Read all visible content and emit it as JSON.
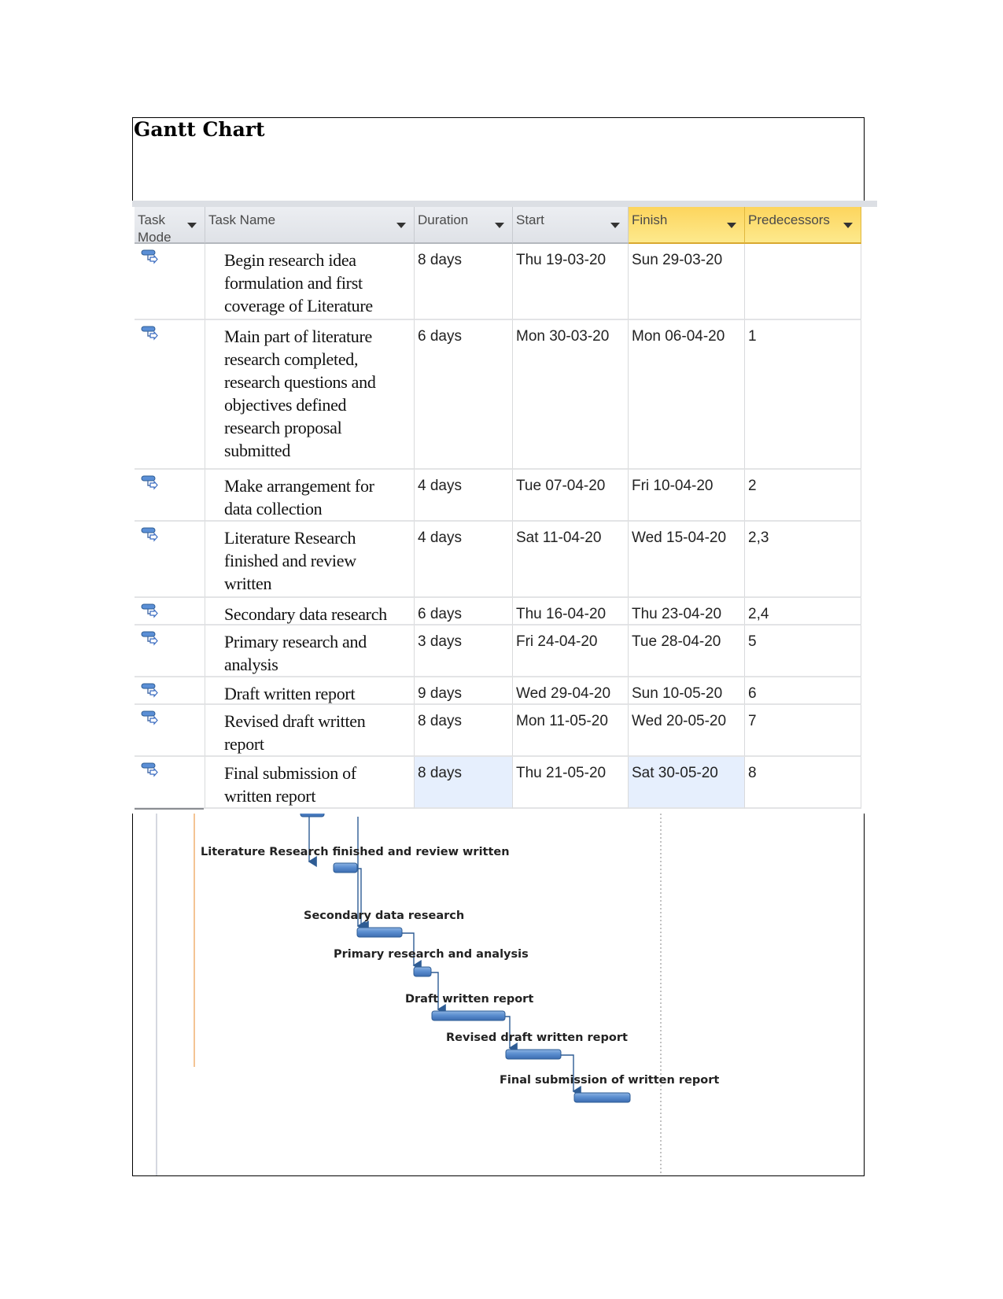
{
  "document": {
    "title": "Gantt Chart"
  },
  "table": {
    "columns": [
      {
        "label": "Task Mode",
        "lines": [
          "Task",
          "Mode"
        ],
        "highlighted": false
      },
      {
        "label": "Task Name",
        "lines": [
          "Task Name"
        ],
        "highlighted": false
      },
      {
        "label": "Duration",
        "lines": [
          "Duration"
        ],
        "highlighted": false
      },
      {
        "label": "Start",
        "lines": [
          "Start"
        ],
        "highlighted": false
      },
      {
        "label": "Finish",
        "lines": [
          "Finish"
        ],
        "highlighted": true
      },
      {
        "label": "Predecessors",
        "lines": [
          "Predecessors"
        ],
        "highlighted": true
      }
    ],
    "rows": [
      {
        "mode_icon": "auto-scheduled-task-icon",
        "name_lines": [
          "Begin research idea",
          "formulation and first",
          "coverage of Literature"
        ],
        "duration": "8 days",
        "start": "Thu 19-03-20",
        "finish": "Sun 29-03-20",
        "predecessors": ""
      },
      {
        "mode_icon": "auto-scheduled-task-icon",
        "name_lines": [
          "Main part of literature",
          "research completed,",
          "research questions and",
          "objectives defined",
          "research proposal",
          "submitted"
        ],
        "duration": "6 days",
        "start": "Mon 30-03-20",
        "finish": "Mon 06-04-20",
        "predecessors": "1"
      },
      {
        "mode_icon": "auto-scheduled-task-icon",
        "name_lines": [
          "Make arrangement for",
          "data collection"
        ],
        "duration": "4 days",
        "start": "Tue 07-04-20",
        "finish": "Fri 10-04-20",
        "predecessors": "2"
      },
      {
        "mode_icon": "auto-scheduled-task-icon",
        "name_lines": [
          "Literature Research",
          "finished and review",
          "written"
        ],
        "duration": "4 days",
        "start": "Sat 11-04-20",
        "finish": "Wed 15-04-20",
        "predecessors": "2,3"
      },
      {
        "mode_icon": "auto-scheduled-task-icon",
        "name_lines": [
          "Secondary data research"
        ],
        "duration": "6 days",
        "start": "Thu 16-04-20",
        "finish": "Thu 23-04-20",
        "predecessors": "2,4"
      },
      {
        "mode_icon": "auto-scheduled-task-icon",
        "name_lines": [
          "Primary research and",
          "analysis"
        ],
        "duration": "3 days",
        "start": "Fri 24-04-20",
        "finish": "Tue 28-04-20",
        "predecessors": "5"
      },
      {
        "mode_icon": "auto-scheduled-task-icon",
        "name_lines": [
          "Draft written report"
        ],
        "duration": "9 days",
        "start": "Wed 29-04-20",
        "finish": "Sun 10-05-20",
        "predecessors": "6"
      },
      {
        "mode_icon": "auto-scheduled-task-icon",
        "name_lines": [
          "Revised draft written",
          "report"
        ],
        "duration": "8 days",
        "start": "Mon 11-05-20",
        "finish": "Wed 20-05-20",
        "predecessors": "7"
      },
      {
        "mode_icon": "auto-scheduled-task-icon",
        "name_lines": [
          "Final submission of",
          "written report"
        ],
        "duration": "8 days",
        "start": "Thu 21-05-20",
        "finish": "Sat 30-05-20",
        "predecessors": "8",
        "selected": true
      }
    ]
  },
  "gantt": {
    "colors": {
      "bar": "#4f81bd",
      "bar_border": "#2e5c94",
      "link": "#2e5c94",
      "today_line": "#f0b070"
    },
    "tasks": [
      {
        "id": 4,
        "label": "Literature Research finished and review written"
      },
      {
        "id": 5,
        "label": "Secondary data research"
      },
      {
        "id": 6,
        "label": "Primary research and analysis"
      },
      {
        "id": 7,
        "label": "Draft written report"
      },
      {
        "id": 8,
        "label": "Revised draft written report"
      },
      {
        "id": 9,
        "label": "Final submission of written report"
      }
    ]
  }
}
